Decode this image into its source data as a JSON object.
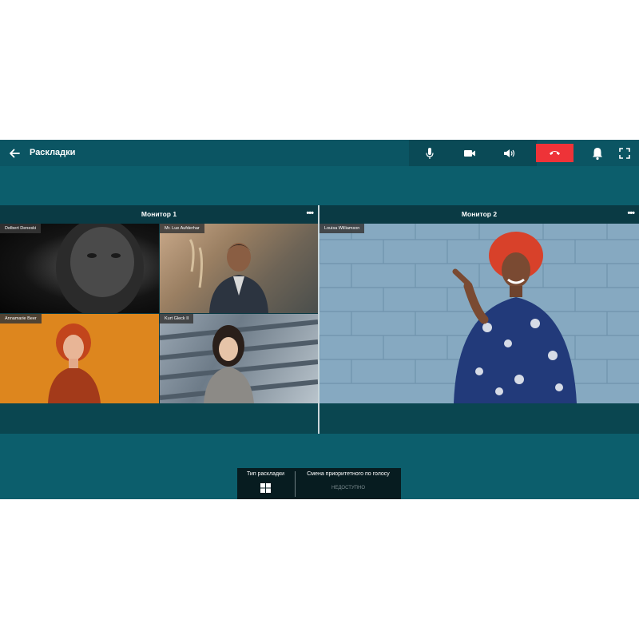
{
  "header": {
    "title": "Раскладки"
  },
  "monitors": [
    {
      "title": "Монитор 1",
      "participants": [
        "Delbert Deneski",
        "Mr. Lue Aufderhar",
        "Annamarie Beer",
        "Kurt Gleck II"
      ]
    },
    {
      "title": "Монитор 2",
      "participants": [
        "Louisa Williamson"
      ]
    }
  ],
  "bottom_panel": {
    "layout_type_label": "Тип раскладки",
    "priority_label": "Смена приоритетного по голосу",
    "priority_state": "НЕДОСТУПНО"
  },
  "colors": {
    "background": "#0c5e6c",
    "hangup": "#ee3338",
    "panel": "#071c20"
  },
  "icons": [
    "back-arrow-icon",
    "microphone-icon",
    "camera-icon",
    "speaker-icon",
    "hangup-icon",
    "bell-icon",
    "fullscreen-icon",
    "more-icon",
    "grid-layout-icon"
  ]
}
